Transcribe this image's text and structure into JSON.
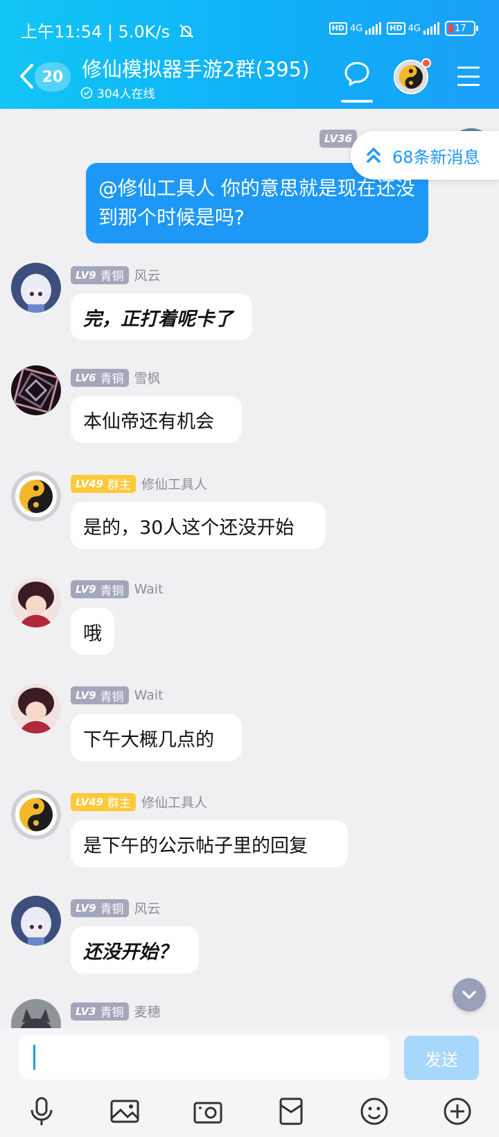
{
  "status": {
    "time": "上午11:54 | 5.0K/s",
    "hd": "HD",
    "net1": "4G",
    "net2": "4G",
    "battery": "17"
  },
  "header": {
    "unread_count": "20",
    "title": "修仙模拟器手游2群(395)",
    "online": "304人在线"
  },
  "new_messages": "68条新消息",
  "my_message": {
    "level": "LV36",
    "text": "@修仙工具人 你的意思就是现在还没到那个时候是吗?"
  },
  "messages": [
    {
      "level": "LV9",
      "title": "青铜",
      "nick": "风云",
      "text": "完，正打着呢卡了",
      "style": "bold-italic",
      "avatar": "blue"
    },
    {
      "level": "LV6",
      "title": "青铜",
      "nick": "雪枫",
      "text": "本仙帝还有机会",
      "style": "normal",
      "avatar": "spiral"
    },
    {
      "level": "LV49",
      "title": "群主",
      "nick": "修仙工具人",
      "text": "是的，30人这个还没开始",
      "style": "normal",
      "avatar": "taiji"
    },
    {
      "level": "LV9",
      "title": "青铜",
      "nick": "Wait",
      "text": "哦",
      "style": "normal",
      "avatar": "red"
    },
    {
      "level": "LV9",
      "title": "青铜",
      "nick": "Wait",
      "text": "下午大概几点的",
      "style": "normal",
      "avatar": "red"
    },
    {
      "level": "LV49",
      "title": "群主",
      "nick": "修仙工具人",
      "text": "是下午的公示帖子里的回复",
      "style": "normal",
      "avatar": "taiji"
    },
    {
      "level": "LV9",
      "title": "青铜",
      "nick": "风云",
      "text": "还没开始？",
      "style": "bold-italic",
      "avatar": "blue"
    },
    {
      "level": "LV3",
      "title": "青铜",
      "nick": "麦穗",
      "text": "",
      "style": "normal",
      "avatar": "gray"
    }
  ],
  "input": {
    "placeholder": "",
    "send_label": "发送"
  },
  "toolbar_icons": [
    "microphone-icon",
    "image-icon",
    "camera-icon",
    "red-packet-icon",
    "emoji-icon",
    "plus-icon"
  ]
}
